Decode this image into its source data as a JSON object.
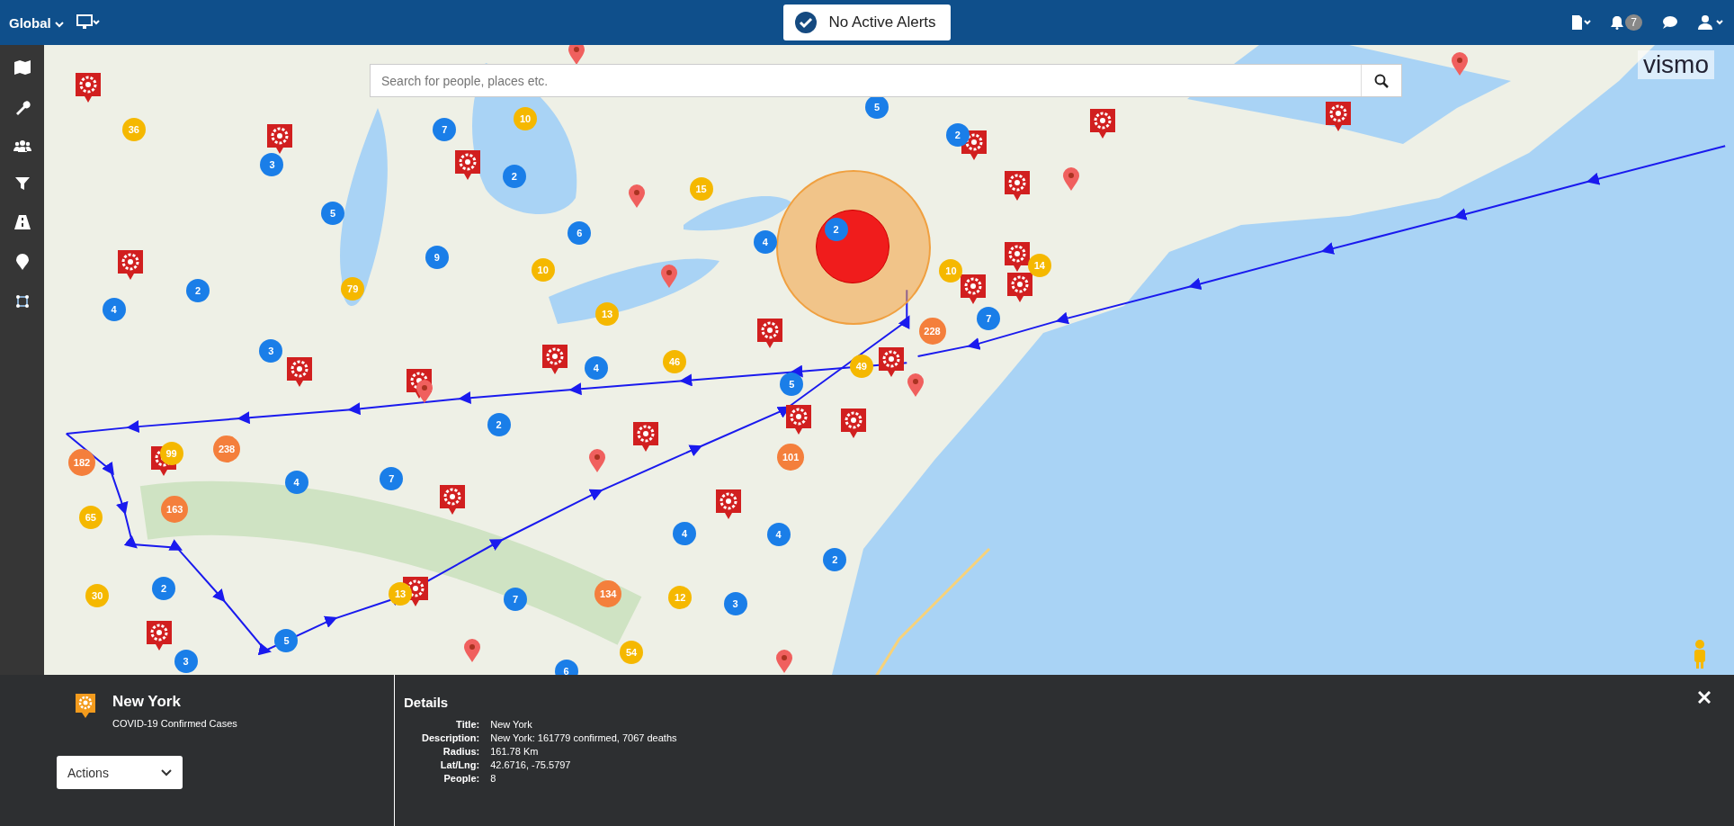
{
  "top_bar": {
    "scope": "Global",
    "alert": "No Active Alerts",
    "notification_count": "7"
  },
  "search": {
    "placeholder": "Search for people, places etc."
  },
  "logo": "vismo",
  "clusters": [
    {
      "count": "36",
      "color": "#f5b800"
    },
    {
      "count": "10",
      "color": "#f5b800"
    },
    {
      "count": "15",
      "color": "#f5b800"
    },
    {
      "count": "79",
      "color": "#f5b800"
    },
    {
      "count": "10",
      "color": "#f5b800"
    },
    {
      "count": "13",
      "color": "#f5b800"
    },
    {
      "count": "46",
      "color": "#f5b800"
    },
    {
      "count": "49",
      "color": "#f5b800"
    },
    {
      "count": "10",
      "color": "#f5b800"
    },
    {
      "count": "14",
      "color": "#f5b800"
    },
    {
      "count": "99",
      "color": "#f5b800"
    },
    {
      "count": "65",
      "color": "#f5b800"
    },
    {
      "count": "30",
      "color": "#f5b800"
    },
    {
      "count": "13",
      "color": "#f5b800"
    },
    {
      "count": "12",
      "color": "#f5b800"
    },
    {
      "count": "54",
      "color": "#f5b800"
    },
    {
      "count": "228",
      "color": "#f47f3c"
    },
    {
      "count": "238",
      "color": "#f47f3c"
    },
    {
      "count": "182",
      "color": "#f47f3c"
    },
    {
      "count": "163",
      "color": "#f47f3c"
    },
    {
      "count": "101",
      "color": "#f47f3c"
    },
    {
      "count": "134",
      "color": "#f47f3c"
    },
    {
      "count": "7",
      "color": "#1a7ee8"
    },
    {
      "count": "3",
      "color": "#1a7ee8"
    },
    {
      "count": "2",
      "color": "#1a7ee8"
    },
    {
      "count": "5",
      "color": "#1a7ee8"
    },
    {
      "count": "6",
      "color": "#1a7ee8"
    },
    {
      "count": "4",
      "color": "#1a7ee8"
    },
    {
      "count": "2",
      "color": "#1a7ee8"
    },
    {
      "count": "9",
      "color": "#1a7ee8"
    },
    {
      "count": "2",
      "color": "#1a7ee8"
    },
    {
      "count": "4",
      "color": "#1a7ee8"
    },
    {
      "count": "3",
      "color": "#1a7ee8"
    },
    {
      "count": "4",
      "color": "#1a7ee8"
    },
    {
      "count": "5",
      "color": "#1a7ee8"
    },
    {
      "count": "2",
      "color": "#1a7ee8"
    },
    {
      "count": "7",
      "color": "#1a7ee8"
    },
    {
      "count": "2",
      "color": "#1a7ee8"
    },
    {
      "count": "5",
      "color": "#1a7ee8"
    },
    {
      "count": "4",
      "color": "#1a7ee8"
    },
    {
      "count": "7",
      "color": "#1a7ee8"
    },
    {
      "count": "4",
      "color": "#1a7ee8"
    },
    {
      "count": "4",
      "color": "#1a7ee8"
    },
    {
      "count": "2",
      "color": "#1a7ee8"
    },
    {
      "count": "2",
      "color": "#1a7ee8"
    },
    {
      "count": "7",
      "color": "#1a7ee8"
    },
    {
      "count": "3",
      "color": "#1a7ee8"
    },
    {
      "count": "3",
      "color": "#1a7ee8"
    },
    {
      "count": "5",
      "color": "#1a7ee8"
    },
    {
      "count": "6",
      "color": "#1a7ee8"
    }
  ],
  "detail_panel": {
    "title": "New York",
    "subtitle": "COVID-19 Confirmed Cases",
    "actions": "Actions",
    "heading": "Details",
    "fields": [
      {
        "label": "Title:",
        "value": "New York"
      },
      {
        "label": "Description:",
        "value": "New York: 161779 confirmed, 7067 deaths"
      },
      {
        "label": "Radius:",
        "value": "161.78 Km"
      },
      {
        "label": "Lat/Lng:",
        "value": "42.6716, -75.5797"
      },
      {
        "label": "People:",
        "value": "8"
      }
    ]
  }
}
